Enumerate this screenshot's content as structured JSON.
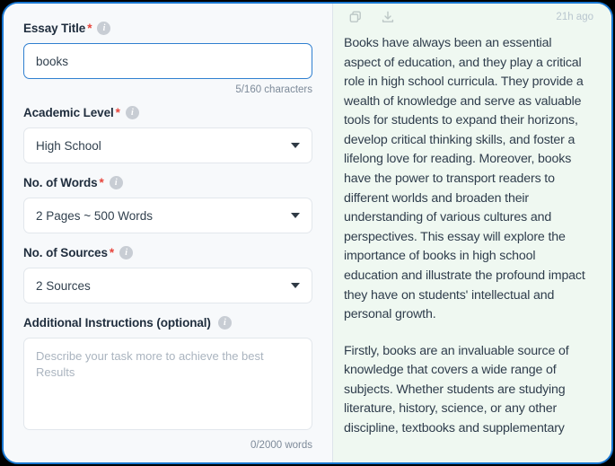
{
  "window": {
    "border_color": "#1877d2",
    "backdrop_color": "#000000"
  },
  "form": {
    "panel_background": "#f7f9fb",
    "fields": [
      {
        "label": "Essay Title",
        "required_marker": "*",
        "info_icon": "info-icon",
        "type": "text",
        "value": "books",
        "placeholder": "",
        "counter": "5/160 characters"
      },
      {
        "label": "Academic Level",
        "required_marker": "*",
        "info_icon": "info-icon",
        "type": "select",
        "value": "High School",
        "caret_icon": "chevron-down-icon"
      },
      {
        "label": "No. of Words",
        "required_marker": "*",
        "info_icon": "info-icon",
        "type": "select",
        "value": "2 Pages ~ 500 Words",
        "caret_icon": "chevron-down-icon"
      },
      {
        "label": "No. of Sources",
        "required_marker": "*",
        "info_icon": "info-icon",
        "type": "select",
        "value": "2 Sources",
        "caret_icon": "chevron-down-icon"
      },
      {
        "label": "Additional Instructions (optional)",
        "required_marker": "",
        "info_icon": "info-icon",
        "type": "textarea",
        "value": "",
        "placeholder": "Describe your task more to achieve the best Results",
        "counter": "0/2000 words"
      }
    ]
  },
  "essay": {
    "panel_background": "#eff8f1",
    "toolbar": {
      "copy_icon": "copy-icon",
      "download_icon": "download-icon",
      "timestamp": "21h ago"
    },
    "paragraphs": [
      "Books have always been an essential aspect of education, and they play a critical role in high school curricula. They provide a wealth of knowledge and serve as valuable tools for students to expand their horizons, develop critical thinking skills, and foster a lifelong love for reading. Moreover, books have the power to transport readers to different worlds and broaden their understanding of various cultures and perspectives. This essay will explore the importance of books in high school education and illustrate the profound impact they have on students' intellectual and personal growth.",
      "Firstly, books are an invaluable source of knowledge that covers a wide range of subjects. Whether students are studying literature, history, science, or any other discipline, textbooks and supplementary"
    ]
  }
}
